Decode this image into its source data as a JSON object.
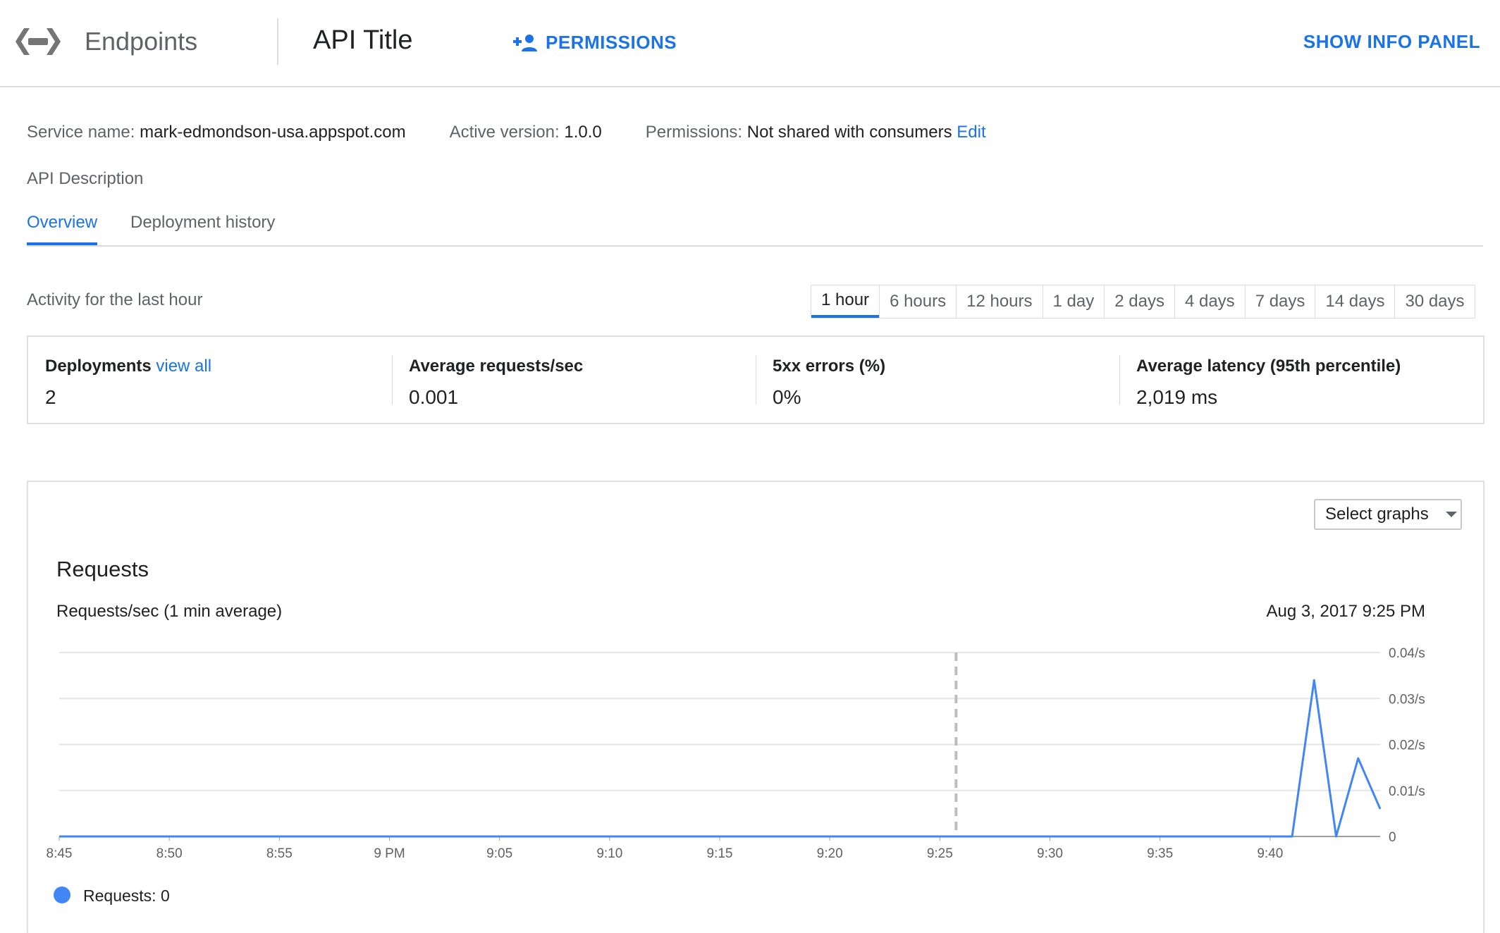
{
  "header": {
    "app_name": "Endpoints",
    "api_title": "API Title",
    "permissions_button": "PERMISSIONS",
    "info_panel_button": "SHOW INFO PANEL",
    "accent_color": "#1a73e8",
    "icons": [
      "endpoints-logo-icon",
      "person-add-icon"
    ]
  },
  "service": {
    "name_label": "Service name:",
    "name_value": "mark-edmondson-usa.appspot.com",
    "version_label": "Active version:",
    "version_value": "1.0.0",
    "permissions_label": "Permissions:",
    "permissions_value": "Not shared with consumers",
    "permissions_link": "Edit"
  },
  "api_description": "API Description",
  "tabs": [
    {
      "label": "Overview",
      "active": true
    },
    {
      "label": "Deployment history",
      "active": false
    }
  ],
  "activity": {
    "label": "Activity for the last hour",
    "ranges": [
      "1 hour",
      "6 hours",
      "12 hours",
      "1 day",
      "2 days",
      "4 days",
      "7 days",
      "14 days",
      "30 days"
    ],
    "selected_range": "1 hour"
  },
  "stats": {
    "deployments_label": "Deployments",
    "deployments_link": "view all",
    "deployments_value": "2",
    "avg_requests_label": "Average requests/sec",
    "avg_requests_value": "0.001",
    "errors_label": "5xx errors (%)",
    "errors_value": "0%",
    "latency_label": "Average latency (95th percentile)",
    "latency_value": "2,019 ms"
  },
  "chart_card": {
    "select_graphs": "Select graphs",
    "title": "Requests",
    "subtitle": "Requests/sec (1 min average)",
    "cursor_time": "Aug 3, 2017 9:25 PM",
    "legend_label": "Requests: 0"
  },
  "chart_data": {
    "type": "line",
    "title": "Requests",
    "subtitle": "Requests/sec (1 min average)",
    "xlabel": "",
    "ylabel": "",
    "x_ticks": [
      "8:45",
      "8:50",
      "8:55",
      "9 PM",
      "9:05",
      "9:10",
      "9:15",
      "9:20",
      "9:25",
      "9:30",
      "9:35",
      "9:40"
    ],
    "y_ticks": [
      "0.04/s",
      "0.03/s",
      "0.02/s",
      "0.01/s",
      "0"
    ],
    "ylim": [
      0,
      0.04
    ],
    "xlim": [
      "8:45",
      "9:45"
    ],
    "cursor_x": "9:25",
    "grid": true,
    "series": [
      {
        "name": "Requests",
        "color": "#4285f4",
        "points": [
          [
            "8:45",
            0
          ],
          [
            "9:00",
            0
          ],
          [
            "9:15",
            0
          ],
          [
            "9:30",
            0
          ],
          [
            "9:40",
            0
          ],
          [
            "9:41",
            0
          ],
          [
            "9:42",
            0.034
          ],
          [
            "9:43",
            0
          ],
          [
            "9:44",
            0.017
          ],
          [
            "9:45",
            0.006
          ]
        ]
      }
    ]
  }
}
